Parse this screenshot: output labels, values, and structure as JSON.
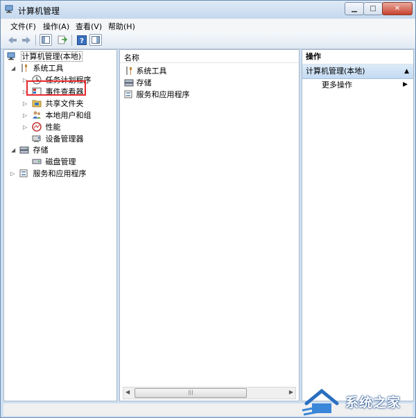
{
  "window": {
    "title": "计算机管理",
    "controls": [
      "minimize",
      "maximize",
      "close"
    ]
  },
  "menu": [
    "文件(F)",
    "操作(A)",
    "查看(V)",
    "帮助(H)"
  ],
  "toolbar": {
    "icons": [
      "back-icon",
      "forward-icon",
      "show-hide-tree-icon",
      "export-list-icon",
      "help-icon",
      "show-hide-action-pane-icon"
    ]
  },
  "tree": {
    "root": "计算机管理(本地)",
    "system_tools": "系统工具",
    "task_scheduler": "任务计划程序",
    "event_viewer": "事件查看器",
    "shared_folders": "共享文件夹",
    "local_users": "本地用户和组",
    "performance": "性能",
    "device_manager": "设备管理器",
    "storage": "存储",
    "disk_management": "磁盘管理",
    "services_apps": "服务和应用程序"
  },
  "list": {
    "header": "名称",
    "items": [
      "系统工具",
      "存储",
      "服务和应用程序"
    ]
  },
  "actions": {
    "header": "操作",
    "section": "计算机管理(本地)",
    "more": "更多操作"
  },
  "watermark": {
    "text": "系统之家"
  },
  "colors": {
    "highlight_box": "#e8272b",
    "action_section": "#c3daf2",
    "title_bar": "#c5d8ee"
  }
}
